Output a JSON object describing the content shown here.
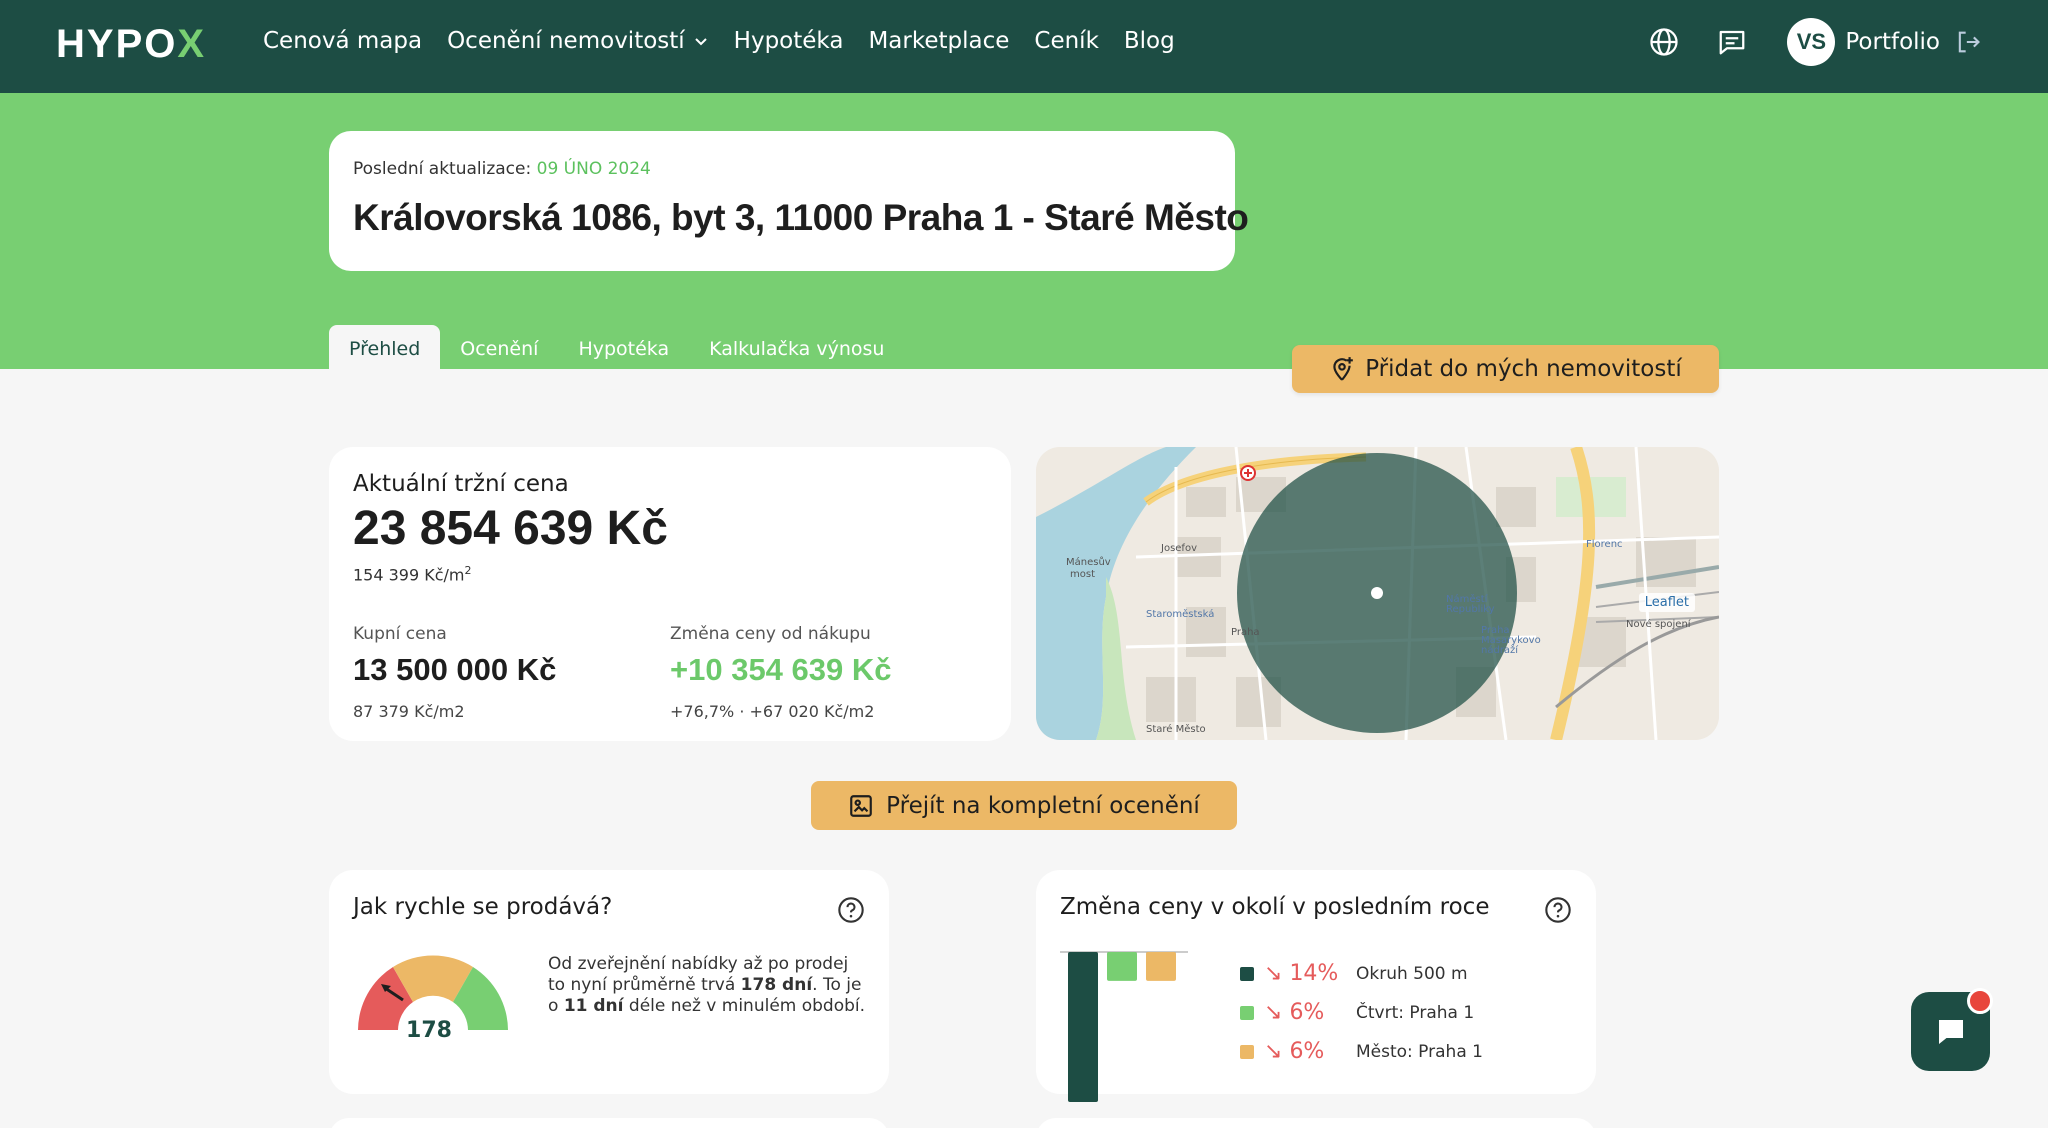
{
  "nav": {
    "logo_main": "HYPO",
    "logo_x": "X",
    "links": [
      "Cenová mapa",
      "Ocenění nemovitostí",
      "Hypotéka",
      "Marketplace",
      "Ceník",
      "Blog"
    ],
    "avatar_initials": "VS",
    "portfolio_label": "Portfolio"
  },
  "header": {
    "update_label": "Poslední aktualizace:",
    "update_date": "09 ÚNO 2024",
    "address": "Královorská 1086, byt 3, 11000 Praha 1 - Staré Město"
  },
  "tabs": [
    "Přehled",
    "Ocenění",
    "Hypotéka",
    "Kalkulačka výnosu"
  ],
  "actions": {
    "add_label": "Přidat do mých nemovitostí",
    "full_valuation_label": "Přejít na kompletní ocenění"
  },
  "price": {
    "current_label": "Aktuální tržní cena",
    "current_value": "23 854 639 Kč",
    "per_m2_value": "154 399 Kč/m",
    "per_m2_sup": "2",
    "purchase_label": "Kupní cena",
    "purchase_value": "13 500 000 Kč",
    "purchase_per_m2": "87 379 Kč/m2",
    "change_label": "Změna ceny od nákupu",
    "change_value": "+10 354 639 Kč",
    "change_detail": "+76,7% · +67 020 Kč/m2"
  },
  "map": {
    "attribution": "Leaflet",
    "labels": [
      "Josefov",
      "Praha",
      "Staroměstská",
      "Staré Město",
      "Florenc",
      "Nové spojení",
      "Náměstí Republiky",
      "Praha Masarykovo nádraží",
      "Mánesův most"
    ]
  },
  "sell_speed": {
    "title": "Jak rychle se prodává?",
    "gauge_value": "178",
    "text_1": "Od zveřejnění nabídky až po prodej to nyní průměrně trvá ",
    "text_days": "178 dní",
    "text_2": ". To je o ",
    "text_diff": "11 dní",
    "text_3": " déle než v minulém období."
  },
  "trend": {
    "title": "Změna ceny v okolí v posledním roce",
    "items": [
      {
        "pct": "14%",
        "name": "Okruh 500 m",
        "color": "#1d4d44"
      },
      {
        "pct": "6%",
        "name": "Čtvrt: Praha 1",
        "color": "#78cf72"
      },
      {
        "pct": "6%",
        "name": "Město: Praha 1",
        "color": "#ecb866"
      }
    ]
  },
  "chart_data": {
    "type": "bar",
    "categories": [
      "Okruh 500 m",
      "Čtvrt: Praha 1",
      "Město: Praha 1"
    ],
    "values": [
      -14,
      -6,
      -6
    ],
    "ylim": [
      -14,
      0
    ]
  }
}
